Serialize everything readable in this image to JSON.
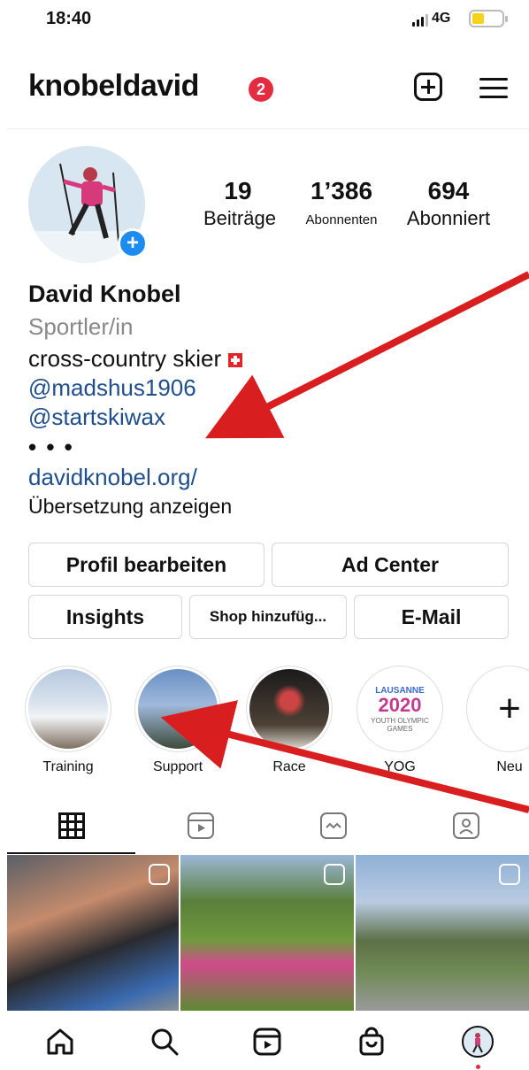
{
  "status_bar": {
    "time": "18:40",
    "network": "4G"
  },
  "header": {
    "username": "knobeldavid",
    "notification_count": "2",
    "create_icon": "plus-square-icon",
    "menu_icon": "hamburger-menu-icon"
  },
  "profile": {
    "stats": [
      {
        "value": "19",
        "label": "Beiträge"
      },
      {
        "value": "1’386",
        "label": "Abonnenten"
      },
      {
        "value": "694",
        "label": "Abonniert"
      }
    ],
    "name": "David Knobel",
    "category": "Sportler/in",
    "bio_line": "cross-country skier",
    "mentions": [
      "@madshus1906",
      "@startskiwax"
    ],
    "more": "• • •",
    "website": "davidknobel.org/",
    "translate": "Übersetzung anzeigen"
  },
  "buttons": {
    "edit_profile": "Profil bearbeiten",
    "ad_center": "Ad Center",
    "insights": "Insights",
    "shop": "Shop hinzufüg...",
    "email": "E-Mail"
  },
  "highlights": [
    {
      "label": "Training"
    },
    {
      "label": "Support"
    },
    {
      "label": "Race"
    },
    {
      "label": "YOG",
      "art": {
        "top": "LAUSANNE",
        "year": "2020",
        "sub": "YOUTH OLYMPIC GAMES"
      }
    },
    {
      "label": "Neu"
    }
  ],
  "tabs": [
    "grid-icon",
    "reels-icon",
    "igtv-icon",
    "tagged-icon"
  ],
  "nav": [
    "home-icon",
    "search-icon",
    "reels-icon",
    "shop-icon",
    "profile-avatar"
  ],
  "colors": {
    "link": "#1f4e8c",
    "accent_blue": "#1d8cf0",
    "badge_red": "#e52b3f",
    "arrow_red": "#d81e1e"
  }
}
